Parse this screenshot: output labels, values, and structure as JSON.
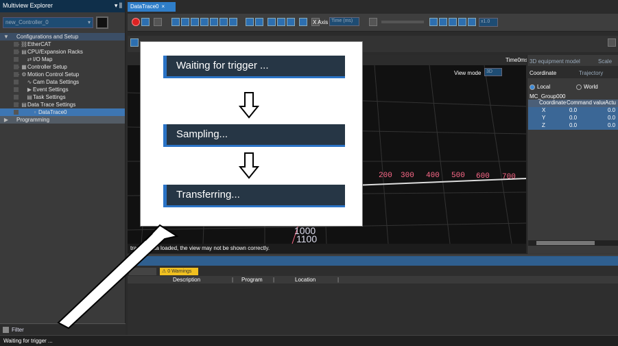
{
  "explorer": {
    "title": "Multiview Explorer",
    "pin": "▾ ⫼",
    "controller": "new_Controller_0",
    "items": [
      {
        "label": "Configurations and Setup",
        "indent": 0,
        "arrow": "▼",
        "icon": "",
        "style": "sel-head"
      },
      {
        "label": "EtherCAT",
        "indent": 2,
        "arrow": "▶",
        "icon": "⛓",
        "style": ""
      },
      {
        "label": "CPU/Expansion Racks",
        "indent": 2,
        "arrow": "▶",
        "icon": "▤",
        "style": ""
      },
      {
        "label": "I/O Map",
        "indent": 3,
        "arrow": "",
        "icon": "⇄",
        "style": ""
      },
      {
        "label": "Controller Setup",
        "indent": 2,
        "arrow": "▶",
        "icon": "▦",
        "style": ""
      },
      {
        "label": "Motion Control Setup",
        "indent": 2,
        "arrow": "▶",
        "icon": "⚙",
        "style": ""
      },
      {
        "label": "Cam Data Settings",
        "indent": 3,
        "arrow": "",
        "icon": "∿",
        "style": ""
      },
      {
        "label": "Event Settings",
        "indent": 3,
        "arrow": "",
        "icon": "▶",
        "style": ""
      },
      {
        "label": "Task Settings",
        "indent": 3,
        "arrow": "",
        "icon": "▤",
        "style": ""
      },
      {
        "label": "Data Trace Settings",
        "indent": 2,
        "arrow": "▼",
        "icon": "▤",
        "style": ""
      },
      {
        "label": "DataTrace0",
        "indent": 4,
        "arrow": "",
        "icon": "▫",
        "style": "sel"
      },
      {
        "label": "Programming",
        "indent": 0,
        "arrow": "▶",
        "icon": "",
        "style": "prog"
      }
    ],
    "filter_label": "Filter"
  },
  "status_text": "Waiting for trigger ...",
  "doc_tab": {
    "label": "DataTrace0",
    "close": "×"
  },
  "toolbar": {
    "x_axis_label": "X Axis",
    "x_axis_value": "Time (ms)",
    "zoom_value": "x1.0"
  },
  "view": {
    "time_label": "Time0ms",
    "view_mode_label": "View mode",
    "view_mode_value": "3D",
    "axis_numbers": [
      "200",
      "300",
      "400",
      "500",
      "600",
      "700"
    ],
    "z_numbers": [
      "1000",
      "1100"
    ],
    "warning": "tracing data  loaded, the view may not be shown correctly."
  },
  "right_panel": {
    "tab_model": "3D equipment model",
    "tab_scale": "Scale",
    "tab_coordinate": "Coordinate",
    "tab_trajectory": "Trajectory",
    "radio_local": "Local",
    "radio_world": "World",
    "group": "MC_Group000",
    "table_headers": [
      "Coordinate",
      "Command value",
      "Actu"
    ],
    "rows": [
      {
        "axis": "X",
        "cmd": "0.0",
        "act": "0.0"
      },
      {
        "axis": "Y",
        "cmd": "0.0",
        "act": "0.0"
      },
      {
        "axis": "Z",
        "cmd": "0.0",
        "act": "0.0"
      }
    ]
  },
  "output": {
    "warnings_chip": "0 Warnings",
    "columns": [
      "Description",
      "Program",
      "Location"
    ]
  },
  "callout": {
    "steps": [
      "Waiting for trigger ...",
      "Sampling...",
      "Transferring..."
    ]
  }
}
